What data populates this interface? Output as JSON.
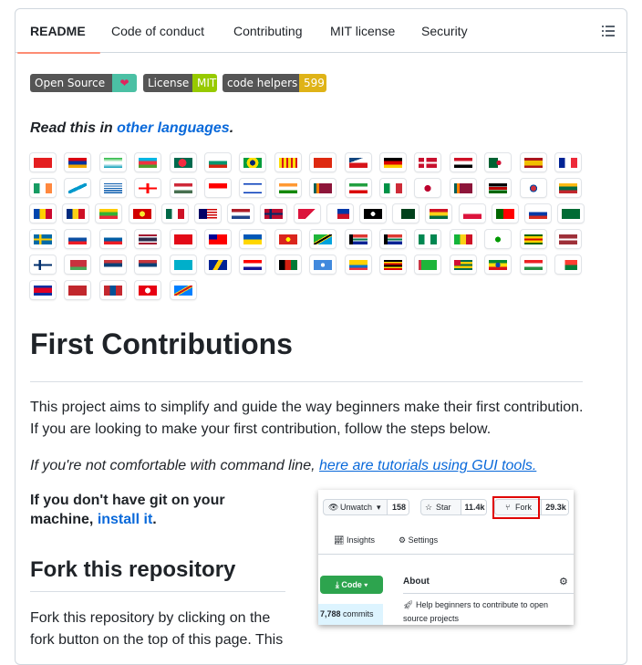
{
  "tabs": [
    {
      "label": "README",
      "active": true
    },
    {
      "label": "Code of conduct"
    },
    {
      "label": "Contributing"
    },
    {
      "label": "MIT license"
    },
    {
      "label": "Security"
    }
  ],
  "badges": {
    "open_source": {
      "label": "Open Source",
      "value": "❤"
    },
    "license": {
      "label": "License",
      "value": "MIT"
    },
    "code_helpers": {
      "label": "code helpers",
      "value": "599"
    }
  },
  "intro": {
    "prefix": "Read this in ",
    "link": "other languages",
    "suffix": "."
  },
  "flags": [
    [
      "albania",
      "armenia",
      "uzbekistan",
      "azerbaijan",
      "bangladesh",
      "bulgaria",
      "brazil",
      "catalonia",
      "china",
      "czechia",
      "germany",
      "denmark",
      "egypt",
      "algeria",
      "spain",
      "france"
    ],
    [
      "ireland",
      "galicia",
      "greece",
      "georgia",
      "hungary",
      "indonesia",
      "israel",
      "india",
      "sri-lanka",
      "iran",
      "italy",
      "japan",
      "sri-lanka-2",
      "kenya",
      "south-korea",
      "lithuania"
    ],
    [
      "moldova",
      "romania",
      "myanmar",
      "north-macedonia",
      "mexico",
      "malaysia",
      "netherlands",
      "norway",
      "nepal",
      "philippines",
      "pirate",
      "pakistan",
      "ghana",
      "poland",
      "portugal",
      "russia",
      "saudi-arabia"
    ],
    [
      "sweden",
      "slovakia",
      "slovenia",
      "thailand",
      "turkey",
      "taiwan",
      "ukraine",
      "vietnam",
      "tanzania",
      "south-africa",
      "south-africa-2",
      "nigeria",
      "mali",
      "bahrain-esperanto",
      "zimbabwe",
      "latvia"
    ],
    [
      "finland",
      "belarus",
      "serbia",
      "serbia-2",
      "kazakhstan",
      "bosnia",
      "croatia",
      "afghanistan",
      "somalia",
      "ecuador",
      "uganda",
      "turkmenistan",
      "togo",
      "ethiopia",
      "kurdistan",
      "madagascar"
    ],
    [
      "cambodia",
      "morocco",
      "mongolia",
      "tunisia",
      "dr-congo"
    ]
  ],
  "heading": "First Contributions",
  "para1": "This project aims to simplify and guide the way beginners make their first contribution. If you are looking to make your first contribution, follow the steps below.",
  "para2": {
    "prefix": "If you're not comfortable with command line, ",
    "link": "here are tutorials using GUI tools."
  },
  "git_note": {
    "prefix": "If you don't have git on your machine, ",
    "link": "install it",
    "suffix": "."
  },
  "fork_heading": "Fork this repository",
  "fork_text": "Fork this repository by clicking on the fork button on the top of this page. This",
  "screenshot": {
    "unwatch": "Unwatch",
    "unwatch_count": "158",
    "star": "Star",
    "star_count": "11.4k",
    "fork": "Fork",
    "fork_count": "29.3k",
    "insights": "Insights",
    "settings": "Settings",
    "code_button": "Code",
    "about": "About",
    "commits_count": "7,788",
    "commits_label": "commits",
    "description": "Help beginners to contribute to open source projects"
  }
}
